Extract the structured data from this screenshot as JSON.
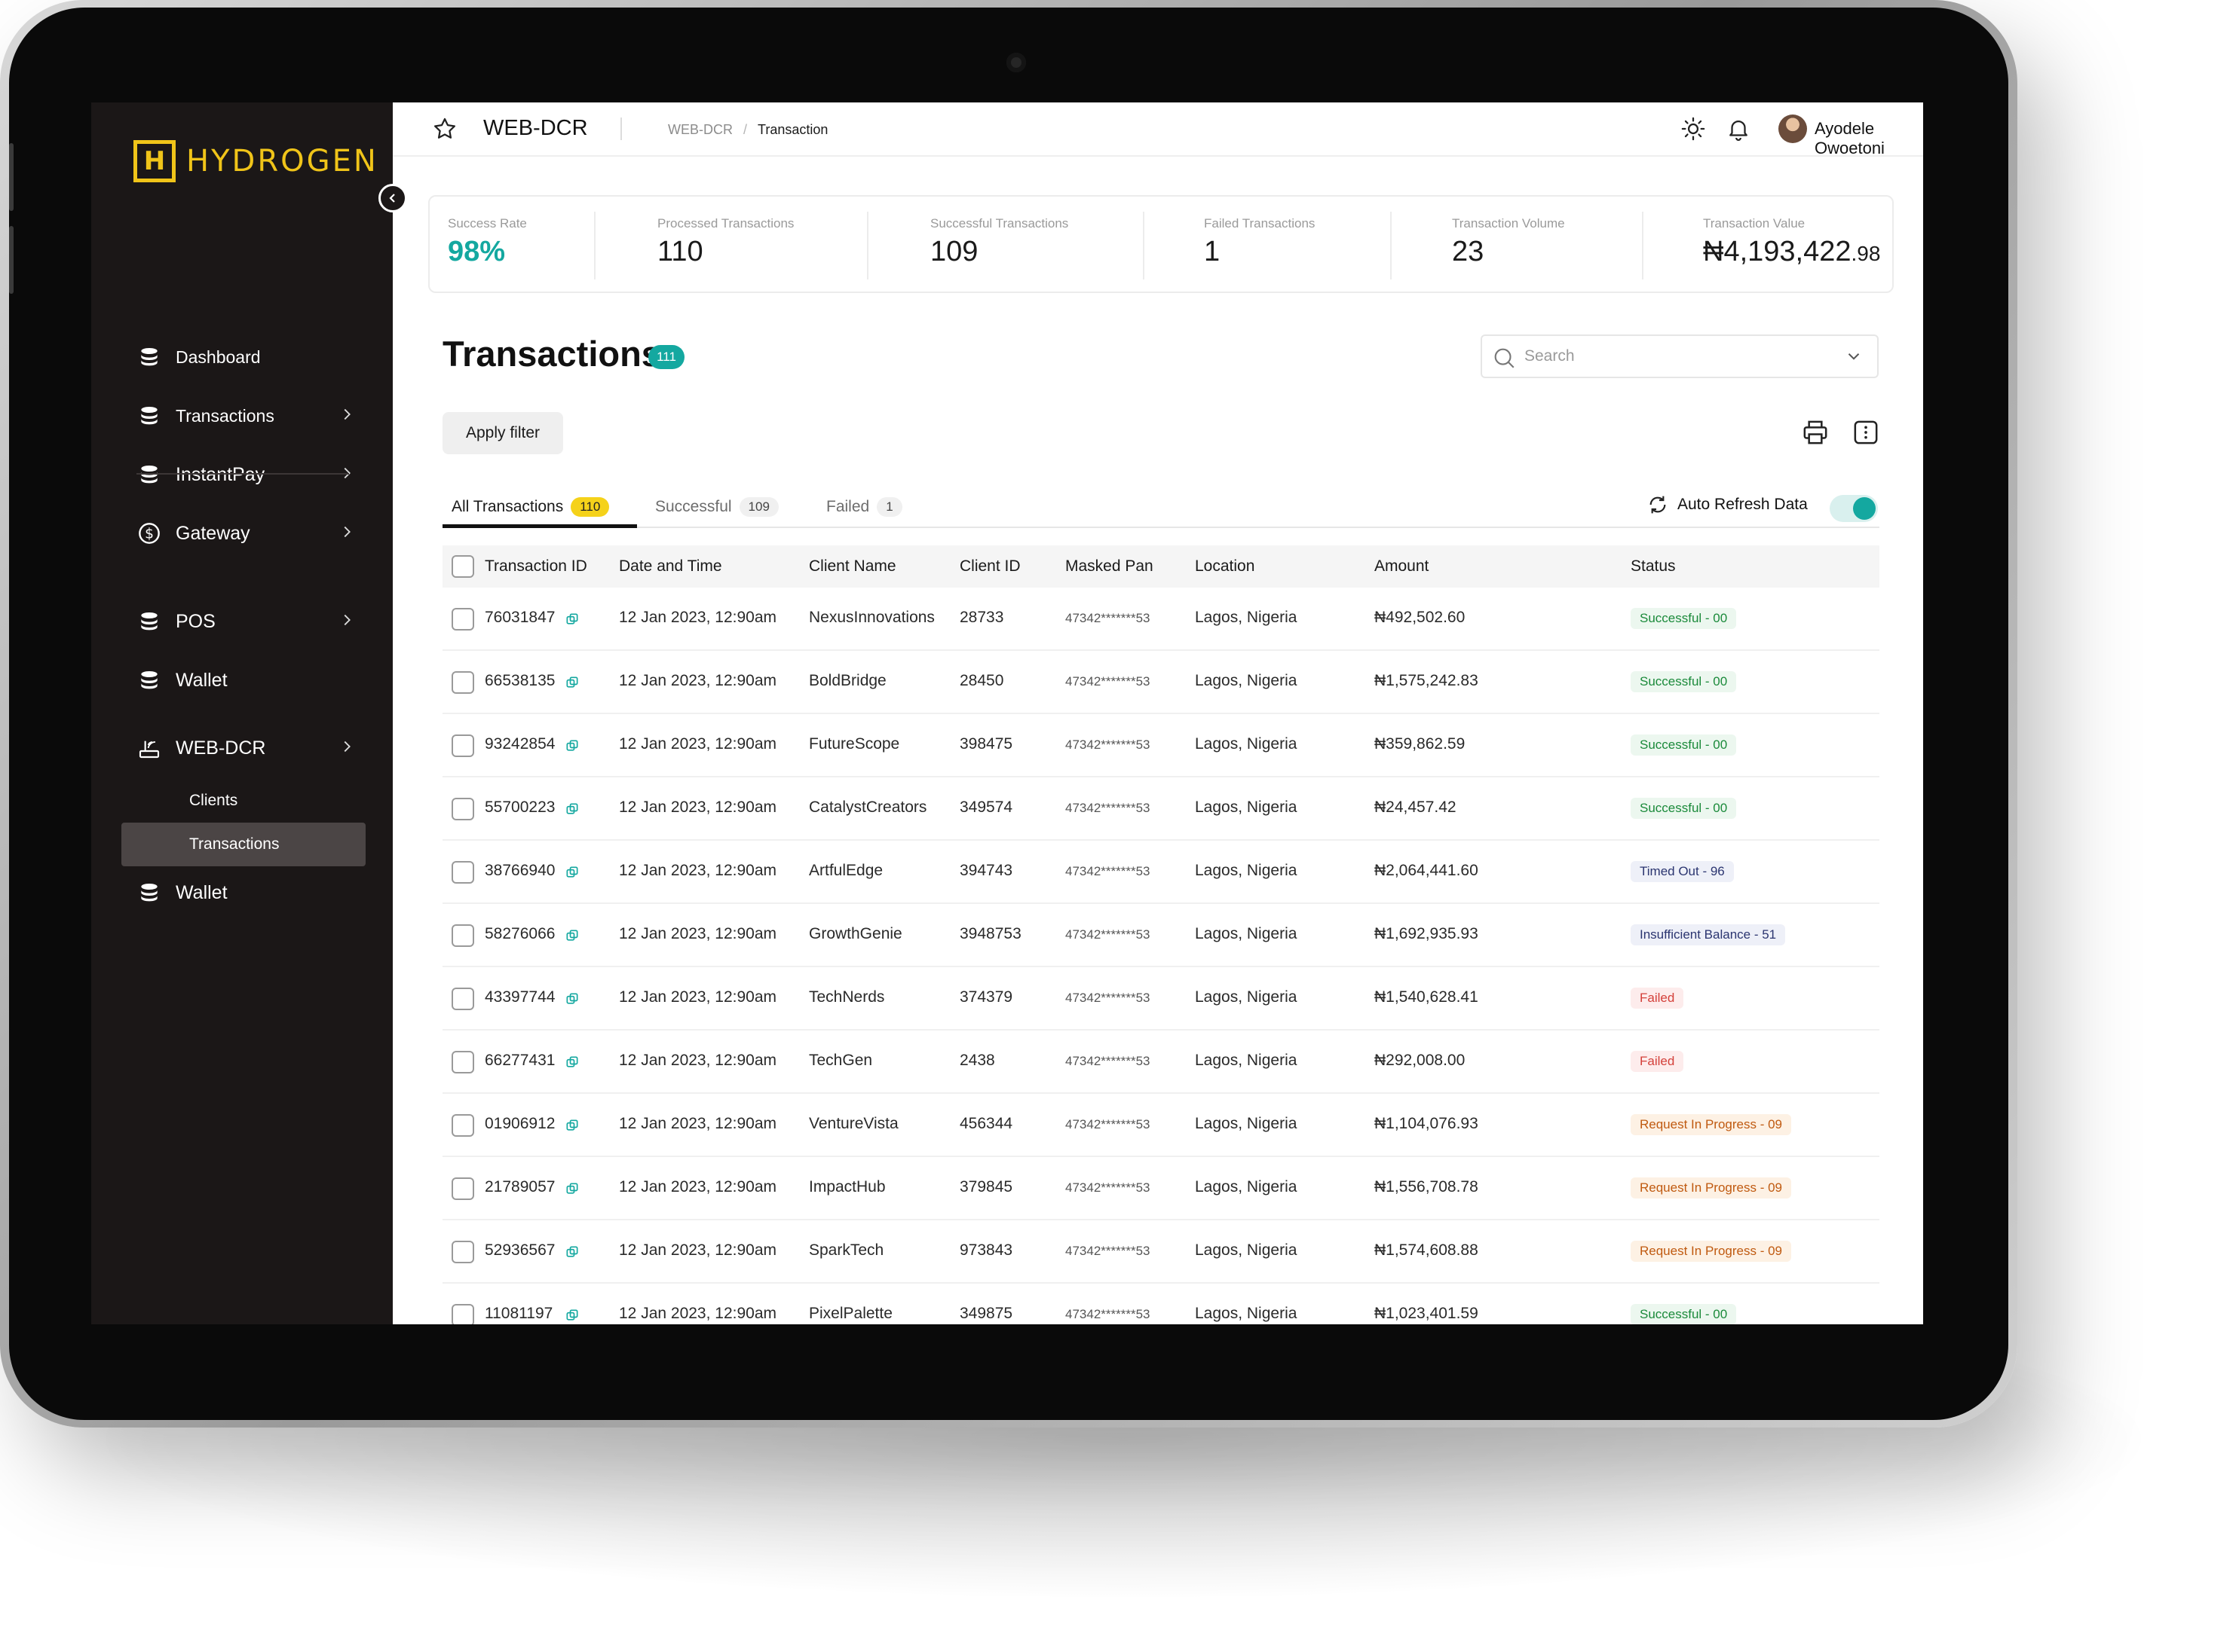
{
  "brand": {
    "name": "HYDROGEN",
    "accent": "#f0c419",
    "teal": "#14a8a0"
  },
  "sidebar": {
    "items": [
      {
        "label": "Dashboard",
        "icon": "coins-stack-icon",
        "has_chevron": false
      },
      {
        "label": "Transactions",
        "icon": "coins-stack-icon",
        "has_chevron": true
      },
      {
        "label": "InstantPay",
        "icon": "coins-stack-icon",
        "has_chevron": true
      },
      {
        "label": "Gateway",
        "icon": "dollar-circle-icon",
        "has_chevron": true
      },
      {
        "label": "POS",
        "icon": "coins-stack-icon",
        "has_chevron": true
      },
      {
        "label": "Wallet",
        "icon": "coins-stack-icon",
        "has_chevron": false
      },
      {
        "label": "WEB-DCR",
        "icon": "router-icon",
        "has_chevron": true
      }
    ],
    "sub_items": [
      {
        "label": "Clients",
        "active": false
      },
      {
        "label": "Transactions",
        "active": true
      }
    ],
    "last_item": {
      "label": "Wallet",
      "icon": "coins-stack-icon"
    }
  },
  "topbar": {
    "title": "WEB-DCR",
    "breadcrumb": [
      "WEB-DCR",
      "Transaction"
    ],
    "user_name": "Ayodele Owoetoni"
  },
  "stats": [
    {
      "label": "Success Rate",
      "value": "98%",
      "accent": true
    },
    {
      "label": "Processed Transactions",
      "value": "110"
    },
    {
      "label": "Successful Transactions",
      "value": "109"
    },
    {
      "label": "Failed Transactions",
      "value": "1"
    },
    {
      "label": "Transaction Volume",
      "value": "23"
    },
    {
      "label": "Transaction Value",
      "value": "₦4,193,422",
      "cents": ".98"
    }
  ],
  "section": {
    "title": "Transactions",
    "count": "111",
    "search_placeholder": "Search",
    "filter_label": "Apply filter"
  },
  "tabs": [
    {
      "label": "All Transactions",
      "count": "110",
      "active": true
    },
    {
      "label": "Successful",
      "count": "109",
      "active": false
    },
    {
      "label": "Failed",
      "count": "1",
      "active": false
    }
  ],
  "auto_refresh": {
    "label": "Auto Refresh Data",
    "enabled": true
  },
  "table": {
    "columns": [
      "Transaction ID",
      "Date and Time",
      "Client Name",
      "Client ID",
      "Masked Pan",
      "Location",
      "Amount",
      "Status"
    ],
    "rows": [
      {
        "id": "76031847",
        "date": "12 Jan 2023, 12:90am",
        "client": "NexusInnovations",
        "client_id": "28733",
        "pan": "47342*******53",
        "location": "Lagos, Nigeria",
        "amount": "₦492,502.60",
        "status": "Successful - 00",
        "status_type": "success"
      },
      {
        "id": "66538135",
        "date": "12 Jan 2023, 12:90am",
        "client": "BoldBridge",
        "client_id": "28450",
        "pan": "47342*******53",
        "location": "Lagos, Nigeria",
        "amount": "₦1,575,242.83",
        "status": "Successful - 00",
        "status_type": "success"
      },
      {
        "id": "93242854",
        "date": "12 Jan 2023, 12:90am",
        "client": "FutureScope",
        "client_id": "398475",
        "pan": "47342*******53",
        "location": "Lagos, Nigeria",
        "amount": "₦359,862.59",
        "status": "Successful - 00",
        "status_type": "success"
      },
      {
        "id": "55700223",
        "date": "12 Jan 2023, 12:90am",
        "client": "CatalystCreators",
        "client_id": "349574",
        "pan": "47342*******53",
        "location": "Lagos, Nigeria",
        "amount": "₦24,457.42",
        "status": "Successful - 00",
        "status_type": "success"
      },
      {
        "id": "38766940",
        "date": "12 Jan 2023, 12:90am",
        "client": "ArtfulEdge",
        "client_id": "394743",
        "pan": "47342*******53",
        "location": "Lagos, Nigeria",
        "amount": "₦2,064,441.60",
        "status": "Timed Out - 96",
        "status_type": "timeout"
      },
      {
        "id": "58276066",
        "date": "12 Jan 2023, 12:90am",
        "client": "GrowthGenie",
        "client_id": "3948753",
        "pan": "47342*******53",
        "location": "Lagos, Nigeria",
        "amount": "₦1,692,935.93",
        "status": "Insufficient Balance - 51",
        "status_type": "balance"
      },
      {
        "id": "43397744",
        "date": "12 Jan 2023, 12:90am",
        "client": "TechNerds",
        "client_id": "374379",
        "pan": "47342*******53",
        "location": "Lagos, Nigeria",
        "amount": "₦1,540,628.41",
        "status": "Failed",
        "status_type": "failed"
      },
      {
        "id": "66277431",
        "date": "12 Jan 2023, 12:90am",
        "client": "TechGen",
        "client_id": "2438",
        "pan": "47342*******53",
        "location": "Lagos, Nigeria",
        "amount": "₦292,008.00",
        "status": "Failed",
        "status_type": "failed"
      },
      {
        "id": "01906912",
        "date": "12 Jan 2023, 12:90am",
        "client": "VentureVista",
        "client_id": "456344",
        "pan": "47342*******53",
        "location": "Lagos, Nigeria",
        "amount": "₦1,104,076.93",
        "status": "Request In Progress - 09",
        "status_type": "progress"
      },
      {
        "id": "21789057",
        "date": "12 Jan 2023, 12:90am",
        "client": "ImpactHub",
        "client_id": "379845",
        "pan": "47342*******53",
        "location": "Lagos, Nigeria",
        "amount": "₦1,556,708.78",
        "status": "Request In Progress - 09",
        "status_type": "progress"
      },
      {
        "id": "52936567",
        "date": "12 Jan 2023, 12:90am",
        "client": "SparkTech",
        "client_id": "973843",
        "pan": "47342*******53",
        "location": "Lagos, Nigeria",
        "amount": "₦1,574,608.88",
        "status": "Request In Progress - 09",
        "status_type": "progress"
      },
      {
        "id": "11081197",
        "date": "12 Jan 2023, 12:90am",
        "client": "PixelPalette",
        "client_id": "349875",
        "pan": "47342*******53",
        "location": "Lagos, Nigeria",
        "amount": "₦1,023,401.59",
        "status": "Successful - 00",
        "status_type": "success"
      }
    ]
  }
}
